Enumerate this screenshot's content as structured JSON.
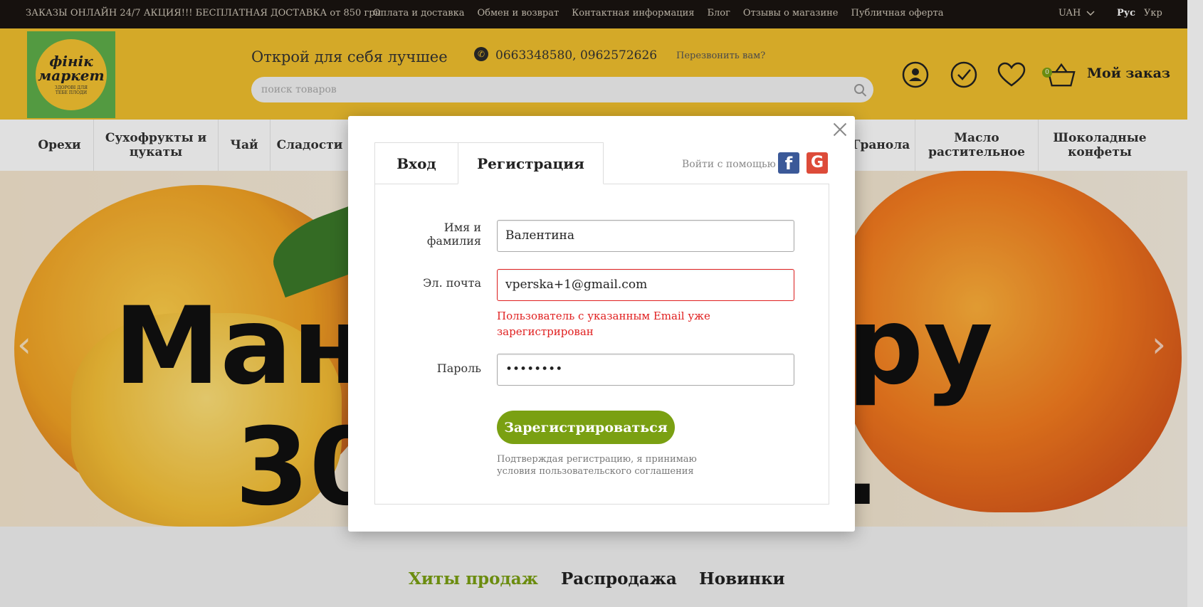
{
  "topbar": {
    "promo": "ЗАКАЗЫ ОНЛАЙН 24/7 АКЦИЯ!!! БЕСПЛАТНАЯ ДОСТАВКА от 850 грн",
    "links": [
      "Оплата и доставка",
      "Обмен и возврат",
      "Контактная информация",
      "Блог",
      "Отзывы о магазине",
      "Публичная оферта"
    ],
    "currency": "UAH",
    "lang_ru": "Рус",
    "lang_ua": "Укр"
  },
  "header": {
    "logo_text": "фінік маркет",
    "logo_sub": "ЗДОРОВІ ДЛЯ ТЕБЕ ПЛОДИ",
    "slogan": "Открой для себя лучшее",
    "phones": "0663348580,   0962572626",
    "callback": "Перезвонить вам?",
    "search_placeholder": "поиск товаров",
    "basket_count": "0",
    "my_order": "Мой заказ"
  },
  "nav": {
    "items": [
      "Орехи",
      "Сухофрукты и цукаты",
      "Чай",
      "Сладости",
      "Гранола",
      "Масло растительное",
      "Шоколадные конфеты"
    ]
  },
  "banner": {
    "text1": "Ман",
    "text2": "ру",
    "text3": "30",
    "text4": "."
  },
  "bottom_tabs": {
    "hits": "Хиты продаж",
    "sale": "Распродажа",
    "new": "Новинки",
    "active_color": "#7aa012"
  },
  "modal": {
    "tab_login": "Вход",
    "tab_register": "Регистрация",
    "social_label": "Войти с помощью",
    "fields": {
      "name_label": "Имя и фамилия",
      "name_value": "Валентина",
      "email_label": "Эл. почта",
      "email_value": "vperska+1@gmail.com",
      "email_error": "Пользователь с указанным Email уже зарегистрирован",
      "password_label": "Пароль",
      "password_value": "••••••••"
    },
    "submit": "Зарегистрироваться",
    "terms": "Подтверждая регистрацию, я принимаю условия пользовательского соглашения",
    "colors": {
      "accent": "#7aa012",
      "error": "#e02020",
      "facebook": "#3b5998",
      "google": "#dd4b39"
    }
  }
}
